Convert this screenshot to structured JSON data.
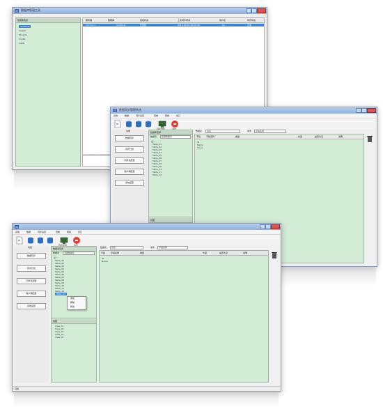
{
  "win1": {
    "title": "数据库管理工具",
    "tree_header": "数据库连接",
    "tree_items": [
      {
        "label": "localhost",
        "selected": true
      },
      {
        "label": "master",
        "selected": false
      },
      {
        "label": "tempdb",
        "selected": false
      },
      {
        "label": "model",
        "selected": false
      },
      {
        "label": "msdb",
        "selected": false
      }
    ],
    "columns": [
      "服务器",
      "数据库",
      "连接状态",
      "上次同步时间",
      "用户名",
      "同步状态"
    ],
    "selected_row": [
      "127.0.0.1",
      "localhost",
      "已连接",
      "2014-03-25 10:25:36",
      "sa",
      "正常"
    ]
  },
  "win2": {
    "title": "数据同步管理系统",
    "menu": [
      "系统",
      "数据",
      "同步设置",
      "查看",
      "帮助",
      "窗口"
    ],
    "toolbar": [
      {
        "icon": "new-icon",
        "label": ""
      },
      {
        "icon": "database-icon",
        "label": ""
      },
      {
        "icon": "database-icon",
        "label": ""
      },
      {
        "icon": "database-icon",
        "label": ""
      },
      {
        "icon": "monitor-icon",
        "label": "同步监控"
      },
      {
        "icon": "stop-icon",
        "label": "退出"
      }
    ],
    "nav_header": "功能",
    "nav_buttons": [
      "数据同步",
      "同步日志",
      "同步表配置",
      "客户端配置",
      "系统设置"
    ],
    "tree_header": "数据库选择",
    "tree_label": "数据表",
    "tree_filter": "全部数据表",
    "tree_items": [
      "表一",
      "Table_01",
      "Table_02",
      "Table_03",
      "Table_04",
      "Table_05",
      "Table_06",
      "Table_07",
      "Table_08",
      "Table_09",
      "Table_10",
      "Table_11",
      "Table_12"
    ],
    "lower_tree_header": "视图",
    "lower_tree_items": [
      "View_01",
      "View_02",
      "View_03",
      "View_04"
    ],
    "query_label": "数据表",
    "query_value": "表名",
    "search_label": "条件",
    "search_value": "字段名称",
    "grid_columns": [
      "字段",
      "字段名称",
      "类型",
      "长度",
      "是否为空",
      "说明"
    ],
    "grid_rows": [
      "ID",
      "Name",
      "Value"
    ]
  },
  "win3": {
    "menu": [
      "系统",
      "数据",
      "同步设置",
      "查看",
      "帮助",
      "窗口"
    ],
    "toolbar": [
      {
        "icon": "new-icon",
        "label": ""
      },
      {
        "icon": "database-icon",
        "label": ""
      },
      {
        "icon": "database-icon",
        "label": ""
      },
      {
        "icon": "database-icon",
        "label": ""
      },
      {
        "icon": "monitor-icon",
        "label": "同步监控"
      },
      {
        "icon": "stop-icon",
        "label": "退出"
      }
    ],
    "nav_header": "功能",
    "nav_buttons": [
      "数据同步",
      "同步日志",
      "同步表配置",
      "客户端配置",
      "系统设置"
    ],
    "tree_header": "数据库选择",
    "tree_label": "数据表",
    "tree_filter": "全部数据表",
    "tree_items": [
      "表一",
      "Table_01",
      "Table_02",
      "Table_03",
      "Table_04",
      "Table_05",
      "Table_06",
      "Table_07",
      "Table_08",
      "Table_09",
      "Table_10",
      "Table_11",
      "Table_12",
      "Table_13"
    ],
    "context_menu": [
      "添加",
      "删除",
      "修改"
    ],
    "lower_tree_header": "视图",
    "lower_tree_items": [
      "View_01",
      "View_02",
      "View_03",
      "View_04",
      "View_05"
    ],
    "query_label": "数据表",
    "query_value": "表名",
    "search_label": "条件",
    "search_value": "字段名称",
    "grid_columns": [
      "字段",
      "字段名称",
      "类型",
      "长度",
      "是否为空",
      "说明"
    ],
    "grid_rows": [
      "ID",
      "Name"
    ],
    "status_text": "就绪"
  },
  "colors": {
    "accent": "#3b83d8",
    "pane_green": "#d3ecd6",
    "titlebar": "#9fbce4",
    "close": "#d9534f"
  }
}
